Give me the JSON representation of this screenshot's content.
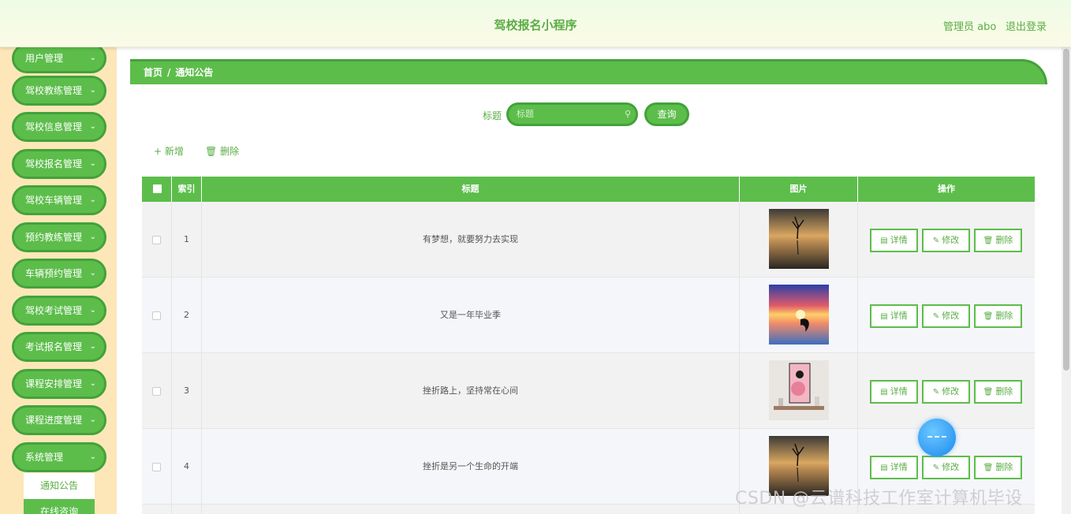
{
  "header": {
    "title": "驾校报名小程序",
    "admin_label": "管理员 abo",
    "logout_label": "退出登录"
  },
  "sidebar": {
    "items": [
      {
        "label": "用户管理"
      },
      {
        "label": "驾校教练管理"
      },
      {
        "label": "驾校信息管理"
      },
      {
        "label": "驾校报名管理"
      },
      {
        "label": "驾校车辆管理"
      },
      {
        "label": "预约教练管理"
      },
      {
        "label": "车辆预约管理"
      },
      {
        "label": "驾校考试管理"
      },
      {
        "label": "考试报名管理"
      },
      {
        "label": "课程安排管理"
      },
      {
        "label": "课程进度管理"
      },
      {
        "label": "系统管理"
      }
    ],
    "submenu": [
      {
        "label": "通知公告"
      },
      {
        "label": "在线咨询"
      }
    ]
  },
  "breadcrumb": {
    "home": "首页",
    "separator": "/",
    "current": "通知公告"
  },
  "search": {
    "label": "标题",
    "placeholder": "标题",
    "button": "查询"
  },
  "actions": {
    "add": "新增",
    "delete": "删除"
  },
  "table": {
    "headers": {
      "index": "索引",
      "title": "标题",
      "image": "图片",
      "ops": "操作"
    },
    "rows": [
      {
        "index": "1",
        "title": "有梦想，就要努力去实现",
        "image": "lake-tree-sunset"
      },
      {
        "index": "2",
        "title": "又是一年毕业季",
        "image": "dolphin-sunset"
      },
      {
        "index": "3",
        "title": "挫折路上，坚持常在心间",
        "image": "pink-painting-room"
      },
      {
        "index": "4",
        "title": "挫折是另一个生命的开端",
        "image": "lake-tree-sunset"
      }
    ],
    "op_labels": {
      "detail": "详情",
      "edit": "修改",
      "delete": "删除"
    }
  },
  "watermark": "CSDN @云谱科技工作室计算机毕设",
  "colors": {
    "primary": "#5dbd4b",
    "primary_dark": "#43a23a",
    "sidebar_bg": "#fde7b8",
    "text_green": "#5bad45"
  }
}
